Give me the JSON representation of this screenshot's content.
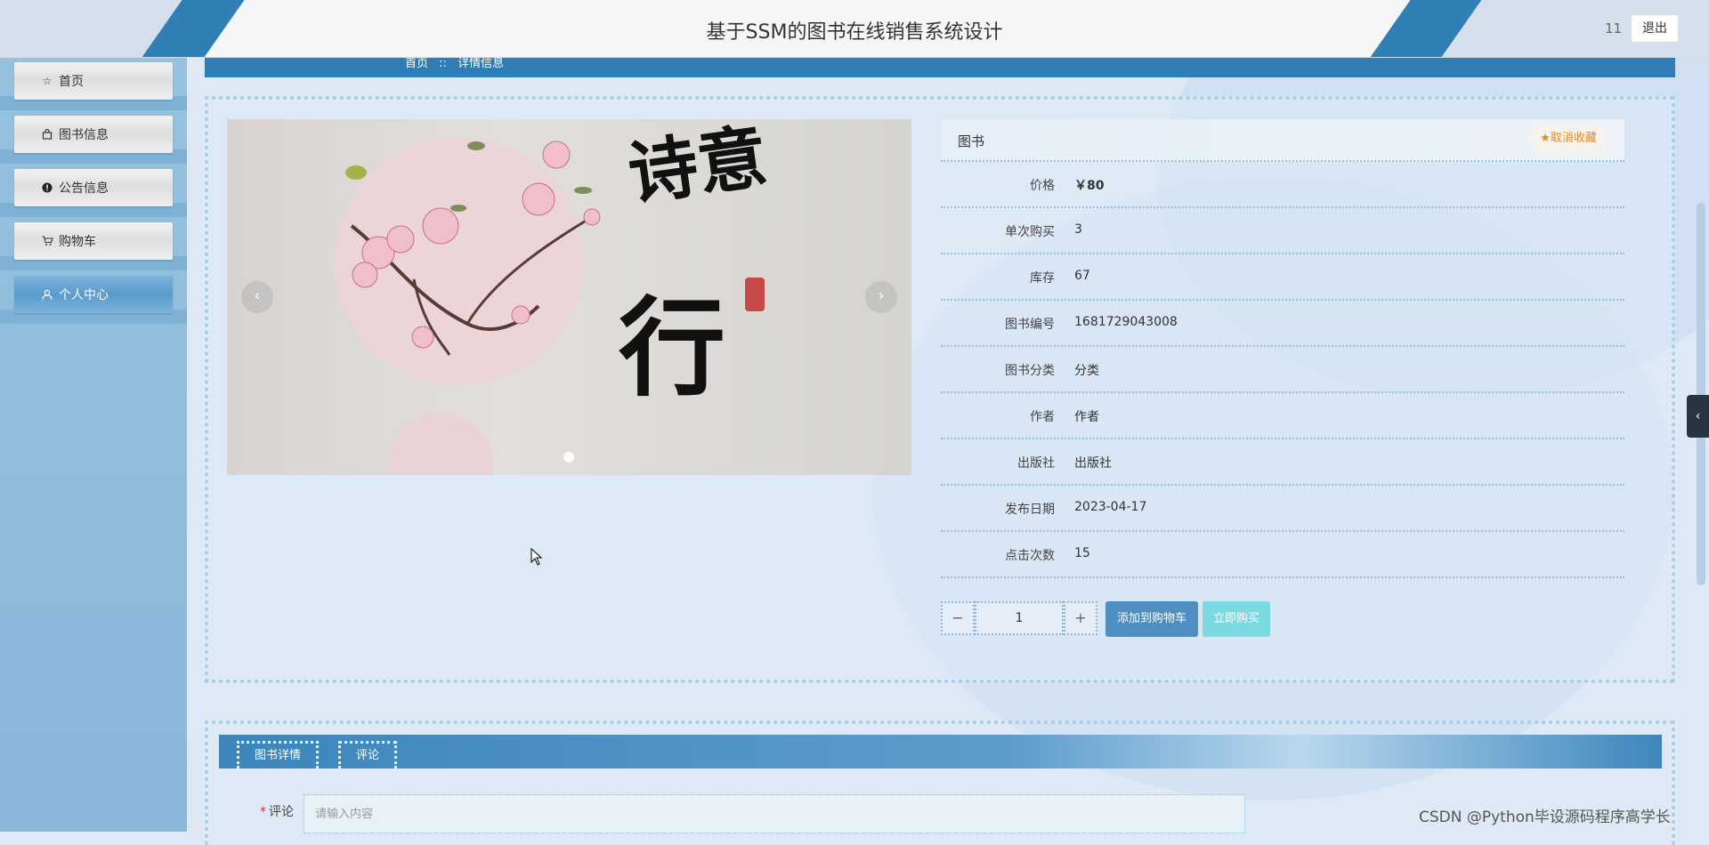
{
  "header": {
    "site_title": "基于SSM的图书在线销售系统设计",
    "username": "11",
    "logout_label": "退出"
  },
  "sidebar": {
    "items": [
      {
        "label": "首页",
        "icon": "star-outline-icon"
      },
      {
        "label": "图书信息",
        "icon": "bag-icon"
      },
      {
        "label": "公告信息",
        "icon": "info-circle-icon"
      },
      {
        "label": "购物车",
        "icon": "cart-icon"
      },
      {
        "label": "个人中心",
        "icon": "user-icon",
        "active": true
      }
    ]
  },
  "breadcrumb": {
    "home": "首页",
    "separator": "::",
    "current": "详情信息"
  },
  "carousel": {
    "prev_icon": "chevron-left-icon",
    "next_icon": "chevron-right-icon",
    "slide_count": 1,
    "active_index": 0
  },
  "product": {
    "title": "图书",
    "favorite_label": "取消收藏",
    "fields": [
      {
        "label": "价格",
        "value": "￥80"
      },
      {
        "label": "单次购买",
        "value": "3"
      },
      {
        "label": "库存",
        "value": "67"
      },
      {
        "label": "图书编号",
        "value": "1681729043008"
      },
      {
        "label": "图书分类",
        "value": "分类"
      },
      {
        "label": "作者",
        "value": "作者"
      },
      {
        "label": "出版社",
        "value": "出版社"
      },
      {
        "label": "发布日期",
        "value": "2023-04-17"
      },
      {
        "label": "点击次数",
        "value": "15"
      }
    ]
  },
  "purchase": {
    "minus": "−",
    "quantity": "1",
    "plus": "+",
    "add_to_cart_label": "添加到购物车",
    "buy_now_label": "立即购买"
  },
  "tabs": [
    {
      "label": "图书详情"
    },
    {
      "label": "评论"
    }
  ],
  "comment": {
    "label": "评论",
    "required_mark": "*",
    "placeholder": "请输入内容"
  },
  "drawer_toggle_icon": "chevron-left-icon",
  "watermark": "CSDN @Python毕设源码程序高学长",
  "colors": {
    "accent": "#2e7db4",
    "favorite": "#e88a22",
    "cart_button": "#4e8ec2",
    "buy_button": "#7dd9e0"
  }
}
